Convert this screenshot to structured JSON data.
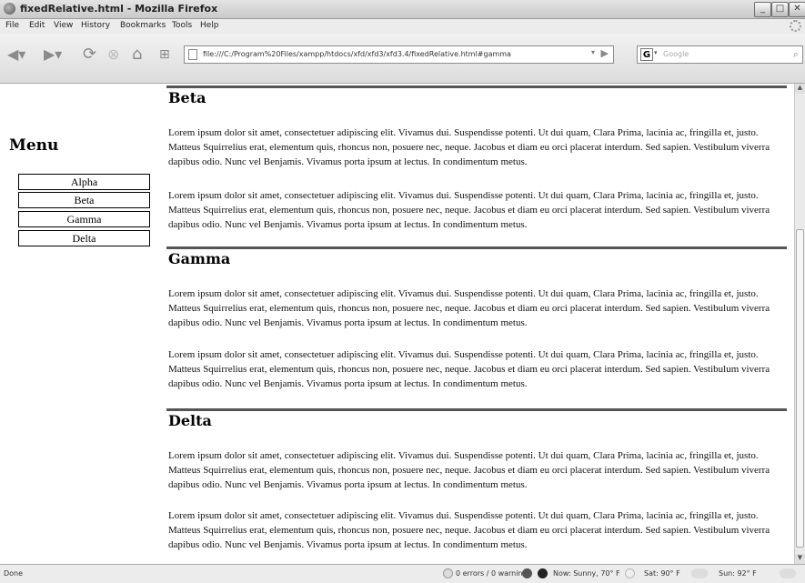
{
  "window": {
    "title": "fixedRelative.html - Mozilla Firefox"
  },
  "menubar": {
    "items": [
      "File",
      "Edit",
      "View",
      "History",
      "Bookmarks",
      "Tools",
      "Help"
    ]
  },
  "toolbar": {
    "url": "file:///C:/Program%20Files/xampp/htdocs/xfd/xfd3/xfd3.4/fixedRelative.html#gamma",
    "search_engine_icon": "G",
    "search_placeholder": "Google"
  },
  "sidebar": {
    "title": "Menu",
    "items": [
      {
        "label": "Alpha"
      },
      {
        "label": "Beta"
      },
      {
        "label": "Gamma"
      },
      {
        "label": "Delta"
      }
    ]
  },
  "sections": [
    {
      "heading": "Beta",
      "paragraphs": [
        "Lorem ipsum dolor sit amet, consectetuer adipiscing elit. Vivamus dui. Suspendisse potenti. Ut dui quam, Clara Prima, lacinia ac, fringilla et, justo. Matteus Squirrelius erat, elementum quis, rhoncus non, posuere nec, neque. Jacobus et diam eu orci placerat interdum. Sed sapien. Vestibulum viverra dapibus odio. Nunc vel Benjamis. Vivamus porta ipsum at lectus. In condimentum metus.",
        "Lorem ipsum dolor sit amet, consectetuer adipiscing elit. Vivamus dui. Suspendisse potenti. Ut dui quam, Clara Prima, lacinia ac, fringilla et, justo. Matteus Squirrelius erat, elementum quis, rhoncus non, posuere nec, neque. Jacobus et diam eu orci placerat interdum. Sed sapien. Vestibulum viverra dapibus odio. Nunc vel Benjamis. Vivamus porta ipsum at lectus. In condimentum metus."
      ]
    },
    {
      "heading": "Gamma",
      "paragraphs": [
        "Lorem ipsum dolor sit amet, consectetuer adipiscing elit. Vivamus dui. Suspendisse potenti. Ut dui quam, Clara Prima, lacinia ac, fringilla et, justo. Matteus Squirrelius erat, elementum quis, rhoncus non, posuere nec, neque. Jacobus et diam eu orci placerat interdum. Sed sapien. Vestibulum viverra dapibus odio. Nunc vel Benjamis. Vivamus porta ipsum at lectus. In condimentum metus.",
        "Lorem ipsum dolor sit amet, consectetuer adipiscing elit. Vivamus dui. Suspendisse potenti. Ut dui quam, Clara Prima, lacinia ac, fringilla et, justo. Matteus Squirrelius erat, elementum quis, rhoncus non, posuere nec, neque. Jacobus et diam eu orci placerat interdum. Sed sapien. Vestibulum viverra dapibus odio. Nunc vel Benjamis. Vivamus porta ipsum at lectus. In condimentum metus."
      ]
    },
    {
      "heading": "Delta",
      "paragraphs": [
        "Lorem ipsum dolor sit amet, consectetuer adipiscing elit. Vivamus dui. Suspendisse potenti. Ut dui quam, Clara Prima, lacinia ac, fringilla et, justo. Matteus Squirrelius erat, elementum quis, rhoncus non, posuere nec, neque. Jacobus et diam eu orci placerat interdum. Sed sapien. Vestibulum viverra dapibus odio. Nunc vel Benjamis. Vivamus porta ipsum at lectus. In condimentum metus.",
        "Lorem ipsum dolor sit amet, consectetuer adipiscing elit. Vivamus dui. Suspendisse potenti. Ut dui quam, Clara Prima, lacinia ac, fringilla et, justo. Matteus Squirrelius erat, elementum quis, rhoncus non, posuere nec, neque. Jacobus et diam eu orci placerat interdum. Sed sapien. Vestibulum viverra dapibus odio. Nunc vel Benjamis. Vivamus porta ipsum at lectus. In condimentum metus."
      ]
    }
  ],
  "statusbar": {
    "left": "Done",
    "errors": "0 errors / 0 warnings",
    "weather_now": "Now: Sunny, 70° F",
    "weather_sat": "Sat: 90° F",
    "weather_sun": "Sun: 92° F"
  },
  "icons": [
    "firefox-icon",
    "back-icon",
    "forward-icon",
    "reload-icon",
    "stop-icon",
    "home-icon",
    "bookmark-icon",
    "page-icon",
    "go-icon",
    "search-icon",
    "throbber-icon",
    "weather-icon"
  ]
}
